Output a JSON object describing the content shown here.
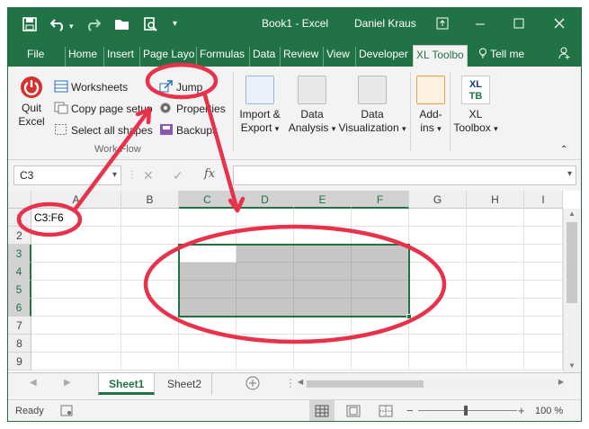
{
  "window": {
    "title": "Book1 - Excel",
    "user": "Daniel Kraus"
  },
  "tabs": [
    "File",
    "Home",
    "Insert",
    "Page Layo",
    "Formulas",
    "Data",
    "Review",
    "View",
    "Developer",
    "XL Toolbo"
  ],
  "tell_me": "Tell me",
  "ribbon": {
    "quit": {
      "line1": "Quit",
      "line2": "Excel"
    },
    "worksheets": "Worksheets",
    "copy_page_setup": "Copy page setup",
    "select_all_shapes": "Select all shapes",
    "jump": "Jump",
    "properties": "Properties",
    "backups": "Backups",
    "group_label": "Work Flow",
    "import_export": {
      "line1": "Import &",
      "line2": "Export"
    },
    "data_analysis": {
      "line1": "Data",
      "line2": "Analysis"
    },
    "data_visualization": {
      "line1": "Data",
      "line2": "Visualization"
    },
    "addins": {
      "line1": "Add-",
      "line2": "ins"
    },
    "xl_toolbox": {
      "line1": "XL",
      "line2": "Toolbox",
      "icon": "XL\nTB"
    }
  },
  "formula_bar": {
    "name_box": "C3",
    "fx": "fx",
    "value": ""
  },
  "grid": {
    "columns": [
      "A",
      "B",
      "C",
      "D",
      "E",
      "F",
      "G",
      "H",
      "I"
    ],
    "rows": [
      "1",
      "2",
      "3",
      "4",
      "5",
      "6",
      "7",
      "8",
      "9"
    ],
    "a1": "C3:F6",
    "selected_range": "C3:F6"
  },
  "sheets": [
    "Sheet1",
    "Sheet2"
  ],
  "status": {
    "ready": "Ready",
    "zoom": "100 %"
  },
  "colors": {
    "excel_green": "#217346",
    "annotation_red": "#e8324b",
    "range_fill": "#c6c6c6"
  }
}
